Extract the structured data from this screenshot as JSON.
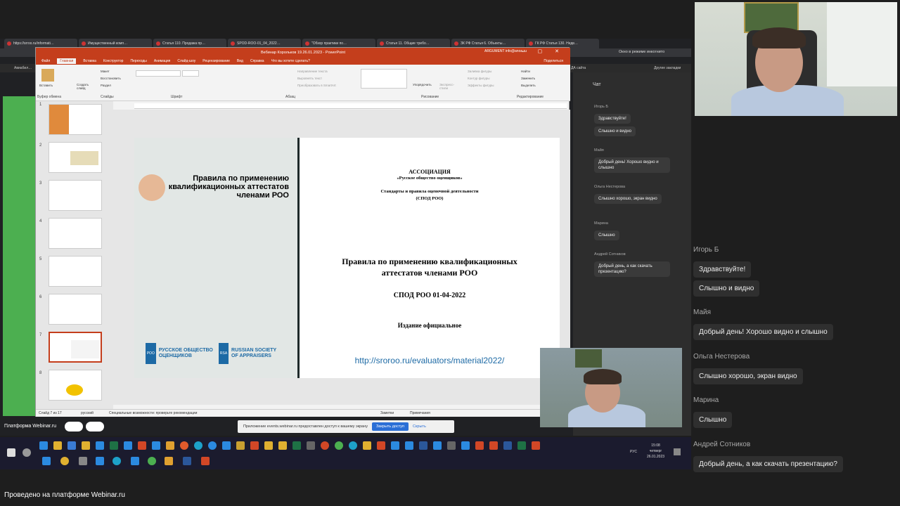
{
  "browser": {
    "tabs": [
      "https://srroo.ru/informati…",
      "Имущественный комп…",
      "Статья 110. Продажа пр…",
      "SPOD-ROO-01_04_2022…",
      "\"Обзор практики по…",
      "Статья 11. Общие требо…",
      "ЗК РФ Статья 6. Объекты…",
      "ГК РФ Статья 130. Недв…"
    ],
    "incognito": "Окно в режиме инкогнито",
    "bookmarks_right": [
      "ДА сайта",
      "Другие закладки"
    ],
    "bookmarks_left": "Авиабил…"
  },
  "ppt": {
    "title": "Вебинар Корольков 19.26.01.2023 - PowerPoint",
    "user": "ARGUMENT info@anoa.ru",
    "share": "Поделиться",
    "menu": [
      "Файл",
      "Главная",
      "Вставка",
      "Конструктор",
      "Переходы",
      "Анимация",
      "Слайд-шоу",
      "Рецензирование",
      "Вид",
      "Справка",
      "Что вы хотите сделать?"
    ],
    "groups": [
      "Буфер обмена",
      "Слайды",
      "Шрифт",
      "Абзац",
      "Рисование",
      "Редактирование"
    ],
    "ribbon": {
      "paste": "Вставить",
      "new_slide": "Создать слайд",
      "layout": "Макет",
      "reset": "Восстановить",
      "section": "Раздел",
      "text_dir": "Направление текста",
      "align_text": "Выровнять текст",
      "smartart": "Преобразовать в SmartArt",
      "arrange": "Упорядочить",
      "quick_styles": "Экспресс-стили",
      "fill": "Заливка фигуры",
      "outline": "Контур фигуры",
      "effects": "Эффекты фигуры",
      "find": "Найти",
      "replace": "Заменить",
      "select": "Выделить"
    },
    "slide_numbers": [
      "1",
      "2",
      "3",
      "4",
      "5",
      "6",
      "7",
      "8"
    ],
    "slide": {
      "heading": "Правила по применению квалификационных аттестатов членами РОО",
      "logo1_abbr": "РОО",
      "logo1": "РУССКОЕ ОБЩЕСТВО ОЦЕНЩИКОВ",
      "logo2_abbr": "RSA",
      "logo2": "RUSSIAN SOCIETY OF APPRAISERS",
      "doc_assoc": "АССОЦИАЦИЯ",
      "doc_org": "«Русское общество оценщиков»",
      "doc_std": "Стандарты и правила оценочной деятельности",
      "doc_spod": "(СПОД РОО)",
      "doc_title": "Правила по применению квалификационных аттестатов членами РОО",
      "doc_code": "СПОД РОО 01-04-2022",
      "doc_edition": "Издание официальное",
      "link": "http://sroroo.ru/evaluators/material2022/"
    },
    "status": {
      "slide_of": "Слайд 7 из 17",
      "lang": "русский",
      "access": "Специальные возможности: проверьте рекомендации",
      "notes": "Заметки",
      "comments": "Примечания"
    }
  },
  "inner_chat": {
    "title": "Чат",
    "messages": [
      {
        "name": "Игорь Б",
        "texts": [
          "Здравствуйте!",
          "Слышно и видно"
        ]
      },
      {
        "name": "Майя",
        "texts": [
          "Добрый день! Хорошо видно и слышно"
        ]
      },
      {
        "name": "Ольга Нестерова",
        "texts": [
          "Слышно хорошо, экран видно"
        ]
      },
      {
        "name": "Марина",
        "texts": [
          "Слышно"
        ]
      },
      {
        "name": "Андрей Сотников",
        "texts": [
          "Добрый день, а как скачать презентацию?"
        ]
      }
    ]
  },
  "chat": {
    "messages": [
      {
        "name": "Игорь Б",
        "texts": [
          "Здравствуйте!",
          "Слышно и видно"
        ]
      },
      {
        "name": "Майя",
        "texts": [
          "Добрый день! Хорошо видно и слышно"
        ]
      },
      {
        "name": "Ольга Нестерова",
        "texts": [
          "Слышно хорошо, экран видно"
        ]
      },
      {
        "name": "Марина",
        "texts": [
          "Слышно"
        ]
      },
      {
        "name": "Андрей Сотников",
        "texts": [
          "Добрый день, а как скачать презентацию?"
        ]
      }
    ]
  },
  "webinar": {
    "platform": "Платформа Webinar.ru",
    "notice": "Приложение events.webinar.ru предоставлен доступ к вашему экрану",
    "stop": "Закрыть доступ",
    "hide": "Скрыть",
    "footer": "Проведено на платформе Webinar.ru"
  },
  "taskbar": {
    "lang": "РУС",
    "time": "15:08",
    "day": "четверг",
    "date": "26.01.2023"
  },
  "colors": {
    "ppt_accent": "#c43e1c",
    "green": "#4caf50",
    "link": "#1d6aa5"
  }
}
